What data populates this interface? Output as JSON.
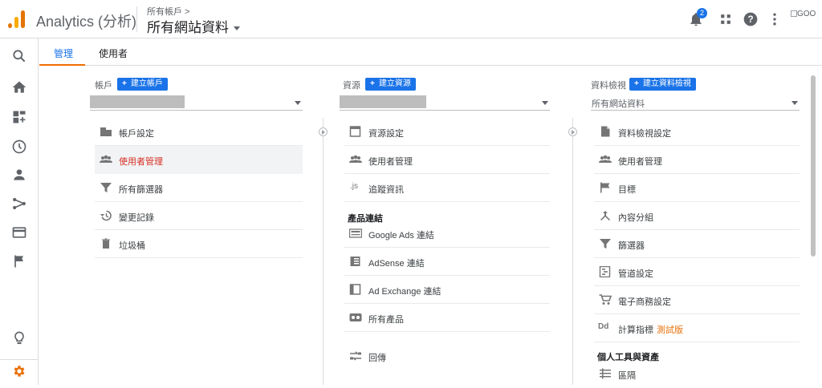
{
  "header": {
    "app_title": "Analytics (分析)",
    "breadcrumb_small": "所有帳戶 >",
    "breadcrumb_property": "所有網站資料",
    "notification_count": "2",
    "avatar_alt": "GOO",
    "icons": [
      "analytics-logo-icon",
      "bell-icon",
      "apps-grid-icon",
      "help-icon",
      "more-vert-icon"
    ]
  },
  "rail": {
    "icons": [
      "search-icon",
      "home-icon",
      "dashboard-add-icon",
      "clock-icon",
      "person-icon",
      "acquisition-icon",
      "behavior-icon",
      "flag-icon",
      "lightbulb-icon",
      "gear-icon"
    ]
  },
  "tabs": [
    {
      "label": "管理",
      "active": true
    },
    {
      "label": "使用者",
      "active": false
    }
  ],
  "account": {
    "heading": "帳戶",
    "create_label": "建立帳戶",
    "items": [
      {
        "label": "帳戶設定",
        "icon": "building-icon"
      },
      {
        "label": "使用者管理",
        "icon": "people-icon",
        "selected": true
      },
      {
        "label": "所有篩選器",
        "icon": "filter-icon"
      },
      {
        "label": "變更記錄",
        "icon": "history-icon"
      },
      {
        "label": "垃圾桶",
        "icon": "trash-icon"
      }
    ]
  },
  "property": {
    "heading": "資源",
    "create_label": "建立資源",
    "items": [
      {
        "label": "資源設定",
        "icon": "window-icon"
      },
      {
        "label": "使用者管理",
        "icon": "people-icon"
      },
      {
        "label": "追蹤資訊",
        "icon": "js-icon",
        "icon_text": ".js"
      }
    ],
    "product_section": "產品連結",
    "product_items": [
      {
        "label": "Google Ads 連結",
        "icon": "ads-icon"
      },
      {
        "label": "AdSense 連結",
        "icon": "adsense-icon"
      },
      {
        "label": "Ad Exchange 連結",
        "icon": "adexchange-icon"
      },
      {
        "label": "所有產品",
        "icon": "products-icon"
      }
    ],
    "postback": {
      "label": "回傳",
      "icon": "postback-icon"
    }
  },
  "view": {
    "heading": "資料檢視",
    "create_label": "建立資料檢視",
    "selected_value": "所有網站資料",
    "items": [
      {
        "label": "資料檢視設定",
        "icon": "document-icon"
      },
      {
        "label": "使用者管理",
        "icon": "people-icon"
      },
      {
        "label": "目標",
        "icon": "flag-icon"
      },
      {
        "label": "內容分組",
        "icon": "merge-icon"
      },
      {
        "label": "篩選器",
        "icon": "filter-icon"
      },
      {
        "label": "管道設定",
        "icon": "funnel-settings-icon"
      },
      {
        "label": "電子商務設定",
        "icon": "cart-icon"
      },
      {
        "label": "計算指標",
        "icon": "dd-icon",
        "icon_text": "Dd",
        "beta": "測試版"
      }
    ],
    "personal_section": "個人工具與資產",
    "segments": {
      "label": "區隔",
      "icon": "segments-icon"
    }
  },
  "colors": {
    "accent_blue": "#1a73e8",
    "active_red": "#d93025",
    "tab_underline": "#ef6c00",
    "beta_orange": "#e8710a"
  }
}
